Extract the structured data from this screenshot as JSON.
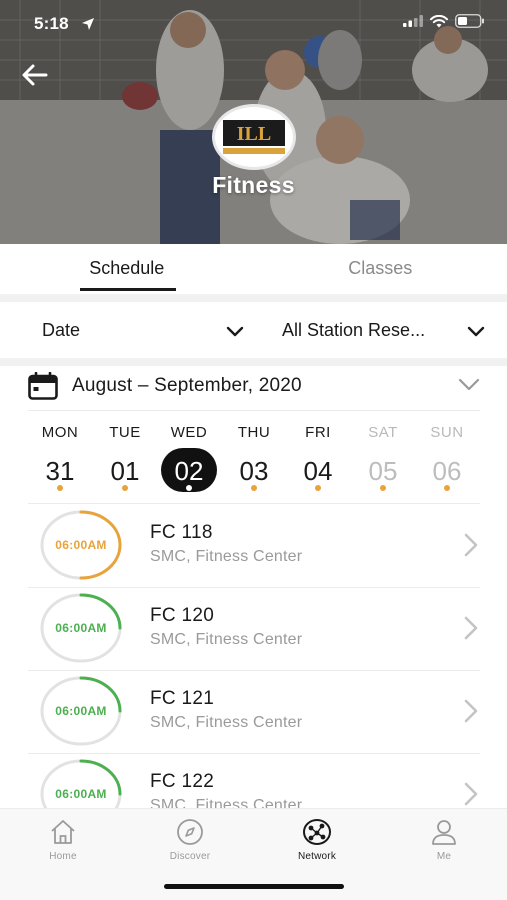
{
  "status_bar": {
    "time": "5:18"
  },
  "header": {
    "title": "Fitness",
    "logo": {
      "text": "ILL"
    }
  },
  "tabs": [
    {
      "label": "Schedule",
      "active": true
    },
    {
      "label": "Classes",
      "active": false
    }
  ],
  "filters": {
    "date_label": "Date",
    "station_label": "All Station Rese..."
  },
  "calendar": {
    "range": "August – September,  2020",
    "weekdays": [
      "MON",
      "TUE",
      "WED",
      "THU",
      "FRI",
      "SAT",
      "SUN"
    ],
    "days": [
      "31",
      "01",
      "02",
      "03",
      "04",
      "05",
      "06"
    ],
    "selected_index": 2
  },
  "reservations": [
    {
      "time": "06:00AM",
      "title": "FC 118",
      "location": "SMC, Fitness Center",
      "ring_color": "#e8a33b",
      "ring_fill": 0.5
    },
    {
      "time": "06:00AM",
      "title": "FC 120",
      "location": "SMC, Fitness Center",
      "ring_color": "#4caf50",
      "ring_fill": 0.25
    },
    {
      "time": "06:00AM",
      "title": "FC 121",
      "location": "SMC, Fitness Center",
      "ring_color": "#4caf50",
      "ring_fill": 0.25
    },
    {
      "time": "06:00AM",
      "title": "FC 122",
      "location": "SMC, Fitness Center",
      "ring_color": "#4caf50",
      "ring_fill": 0.25
    }
  ],
  "nav": [
    {
      "label": "Home",
      "icon": "home-icon",
      "active": false
    },
    {
      "label": "Discover",
      "icon": "compass-icon",
      "active": false
    },
    {
      "label": "Network",
      "icon": "network-icon",
      "active": true
    },
    {
      "label": "Me",
      "icon": "person-icon",
      "active": false
    }
  ],
  "colors": {
    "accent_orange": "#e8a33b",
    "accent_green": "#4caf50",
    "muted_text": "#9a9a9a"
  }
}
